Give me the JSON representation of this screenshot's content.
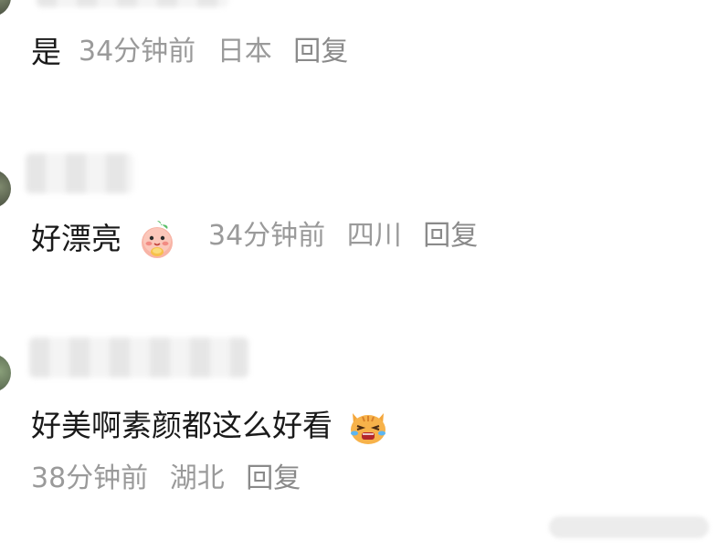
{
  "comments": [
    {
      "text": "是",
      "time": "34分钟前",
      "location": "日本",
      "reply_label": "回复"
    },
    {
      "text": "好漂亮",
      "emoji": "peach-character-emoji",
      "time": "34分钟前",
      "location": "四川",
      "reply_label": "回复"
    },
    {
      "text": "好美啊素颜都这么好看",
      "emoji": "crying-cat-emoji",
      "time": "38分钟前",
      "location": "湖北",
      "reply_label": "回复"
    }
  ],
  "colors": {
    "text": "#1a1a1a",
    "meta": "#9a9a9a",
    "background": "#ffffff"
  }
}
